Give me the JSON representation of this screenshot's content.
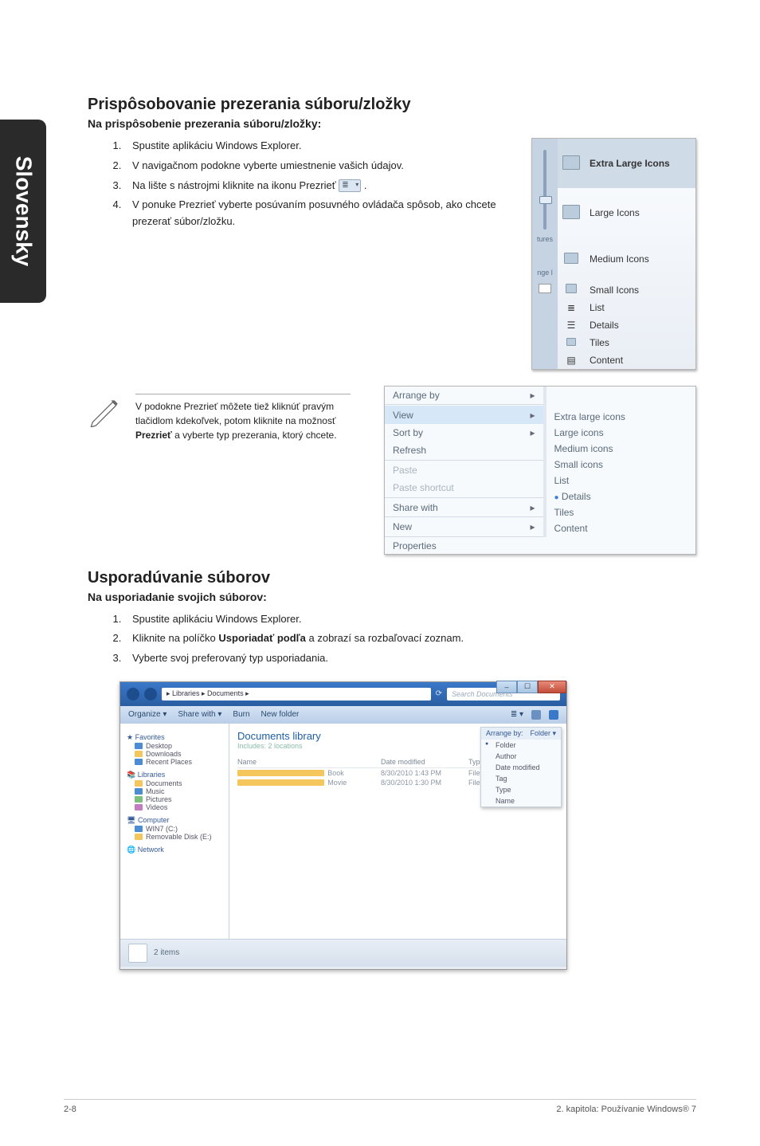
{
  "sidetab": "Slovensky",
  "h2a": "Prispôsobovanie prezerania súboru/zložky",
  "h3a": "Na prispôsobenie prezerania súboru/zložky:",
  "steps_a": {
    "s1": "Spustite aplikáciu Windows Explorer.",
    "s2": "V navigačnom podokne vyberte umiestnenie vašich údajov.",
    "s3a": "Na lište s nástrojmi kliknite na ikonu Prezrieť ",
    "s3b": ".",
    "s4": "V ponuke Prezrieť vyberte posúvaním posuvného ovládača spôsob, ako chcete prezerať súbor/zložku."
  },
  "viewmenu": {
    "xl": "Extra Large Icons",
    "l": "Large Icons",
    "m": "Medium Icons",
    "s": "Small Icons",
    "list": "List",
    "det": "Details",
    "tiles": "Tiles",
    "cont": "Content",
    "leftt1": "tures",
    "leftt2": "nge l"
  },
  "note": {
    "l1": "V podokne Prezrieť môžete tiež kliknúť pravým tlačidlom kdekoľvek, potom kliknite na možnosť ",
    "bold": "Prezrieť",
    "l2": " a vyberte typ prezerania, ktorý chcete."
  },
  "ctx": {
    "arrange": "Arrange by",
    "view": "View",
    "sort": "Sort by",
    "refresh": "Refresh",
    "paste": "Paste",
    "pastesc": "Paste shortcut",
    "share": "Share with",
    "new": "New",
    "prop": "Properties",
    "xl": "Extra large icons",
    "l": "Large icons",
    "m": "Medium icons",
    "s": "Small icons",
    "list": "List",
    "det": "Details",
    "tiles": "Tiles",
    "cont": "Content"
  },
  "h2b": "Usporadúvanie súborov",
  "h3b": "Na usporiadanie svojich súborov:",
  "steps_b": {
    "s1": "Spustite aplikáciu Windows Explorer.",
    "s2a": "Kliknite na políčko ",
    "s2b": "Usporiadať podľa",
    "s2c": " a zobrazí sa rozbaľovací zoznam.",
    "s3": "Vyberte svoj preferovaný typ usporiadania."
  },
  "explorer": {
    "path": "▸ Libraries ▸ Documents ▸",
    "search": "Search Documents",
    "tool_org": "Organize ▾",
    "tool_share": "Share with ▾",
    "tool_burn": "Burn",
    "tool_new": "New folder",
    "nav": {
      "fav": "Favorites",
      "desk": "Desktop",
      "down": "Downloads",
      "recent": "Recent Places",
      "lib": "Libraries",
      "docs": "Documents",
      "music": "Music",
      "pics": "Pictures",
      "vids": "Videos",
      "comp": "Computer",
      "win": "WIN7 (C:)",
      "rem": "Removable Disk (E:)",
      "net": "Network"
    },
    "heading": "Documents library",
    "sub": "Includes: 2 locations",
    "hdr_name": "Name",
    "hdr_date": "Date modified",
    "hdr_type": "Type",
    "rows": [
      {
        "n": "Book",
        "d": "8/30/2010 1:43 PM",
        "t": "File folder"
      },
      {
        "n": "Movie",
        "d": "8/30/2010 1:30 PM",
        "t": "File folder"
      }
    ],
    "arrange_lbl": "Arrange by:",
    "arrange_val": "Folder ▾",
    "opts": {
      "folder": "Folder",
      "author": "Author",
      "date": "Date modified",
      "tag": "Tag",
      "type": "Type",
      "name": "Name"
    },
    "status": "2 items"
  },
  "footer": {
    "left": "2-8",
    "right": "2. kapitola: Používanie Windows® 7"
  }
}
